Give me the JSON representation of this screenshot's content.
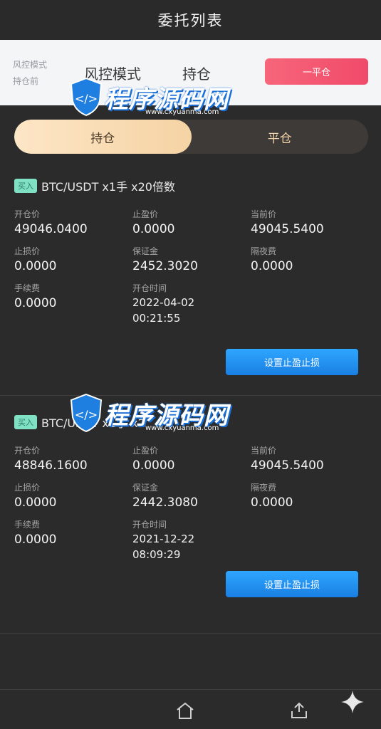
{
  "header": {
    "title": "委托列表"
  },
  "risk": {
    "small_label_1": "风控模式",
    "small_label_2": "持仓前",
    "mode_label": "风控模式",
    "position_label": "持仓",
    "close_button": "一平仓"
  },
  "tabs": [
    {
      "label": "持仓",
      "active": true
    },
    {
      "label": "平仓",
      "active": false
    }
  ],
  "orders": [
    {
      "badge": "买入",
      "title": "BTC/USDT x1手 x20倍数",
      "fields": [
        {
          "label": "开仓价",
          "value": "49046.0400"
        },
        {
          "label": "止盈价",
          "value": "0.0000"
        },
        {
          "label": "当前价",
          "value": "49045.5400"
        },
        {
          "label": "止损价",
          "value": "0.0000"
        },
        {
          "label": "保证金",
          "value": "2452.3020"
        },
        {
          "label": "隔夜费",
          "value": "0.0000"
        },
        {
          "label": "手续费",
          "value": "0.0000"
        },
        {
          "label": "开仓时间",
          "value_date": "2022-04-02",
          "value_time": "00:21:55"
        }
      ],
      "button": "设置止盈止损"
    },
    {
      "badge": "买入",
      "title": "BTC/USDT x1手 x2",
      "fields": [
        {
          "label": "开仓价",
          "value": "48846.1600"
        },
        {
          "label": "止盈价",
          "value": "0.0000"
        },
        {
          "label": "当前价",
          "value": "49045.5400"
        },
        {
          "label": "止损价",
          "value": "0.0000"
        },
        {
          "label": "保证金",
          "value": "2442.3080"
        },
        {
          "label": "隔夜费",
          "value": "0.0000"
        },
        {
          "label": "手续费",
          "value": "0.0000"
        },
        {
          "label": "开仓时间",
          "value_date": "2021-12-22",
          "value_time": "08:09:29"
        }
      ],
      "button": "设置止盈止损"
    }
  ],
  "watermark": {
    "text": "程序源码网",
    "sub": "www.cxyuanma.com"
  },
  "tabbar": {
    "icons": [
      "home-icon",
      "upload-icon"
    ]
  }
}
